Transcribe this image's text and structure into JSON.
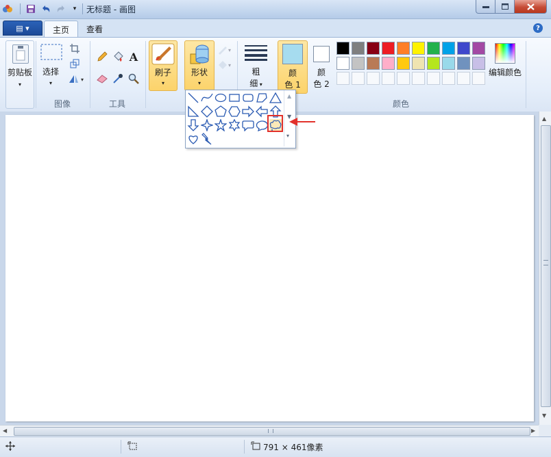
{
  "window": {
    "title": "无标题 - 画图",
    "controls": [
      "minimize",
      "maximize",
      "close"
    ]
  },
  "ribbon": {
    "file_button": "▤ ▾",
    "tabs": [
      {
        "label": "主页",
        "active": true
      },
      {
        "label": "查看",
        "active": false
      }
    ],
    "groups": {
      "clipboard": {
        "label": "剪贴板"
      },
      "image": {
        "label": "图像",
        "select_label": "选择"
      },
      "tools": {
        "label": "工具"
      },
      "brushes": {
        "label": "刷子"
      },
      "shapes": {
        "label": "形状"
      },
      "size": {
        "label_line1": "粗",
        "label_line2": "细"
      },
      "color1": {
        "line1": "颜",
        "line2": "色 1",
        "swatch": "#a6dcef"
      },
      "color2": {
        "line1": "颜",
        "line2": "色 2",
        "swatch": "#ffffff"
      },
      "colors": {
        "label": "颜色",
        "edit_label": "编辑颜色"
      }
    }
  },
  "palette": {
    "row1": [
      "#000000",
      "#7f7f7f",
      "#880015",
      "#ed1c24",
      "#ff7f27",
      "#fff200",
      "#22b14c",
      "#00a2e8",
      "#3f48cc",
      "#a349a4"
    ],
    "row2": [
      "#ffffff",
      "#c3c3c3",
      "#b97a57",
      "#ffaec9",
      "#ffc90e",
      "#efe4b0",
      "#b5e61d",
      "#99d9ea",
      "#7092be",
      "#c8bfe7"
    ],
    "row3_empty_count": 10
  },
  "shapes_dropdown": {
    "rows": [
      [
        "line",
        "curve",
        "oval",
        "rectangle",
        "rounded-rectangle",
        "polygon",
        "triangle"
      ],
      [
        "right-triangle",
        "diamond",
        "pentagon",
        "hexagon",
        "right-arrow",
        "left-arrow",
        "up-arrow"
      ],
      [
        "down-arrow",
        "four-point-star",
        "five-point-star",
        "six-point-star",
        "rounded-callout",
        "oval-callout",
        "cloud-callout"
      ],
      [
        "heart",
        "lightning"
      ]
    ],
    "highlighted": "cloud-callout"
  },
  "status": {
    "canvas_size": "791 × 461像素"
  },
  "colors": {
    "accent": "#2d6cc5",
    "selected_button": "#fcd36b",
    "highlight_box": "#e2312b"
  }
}
